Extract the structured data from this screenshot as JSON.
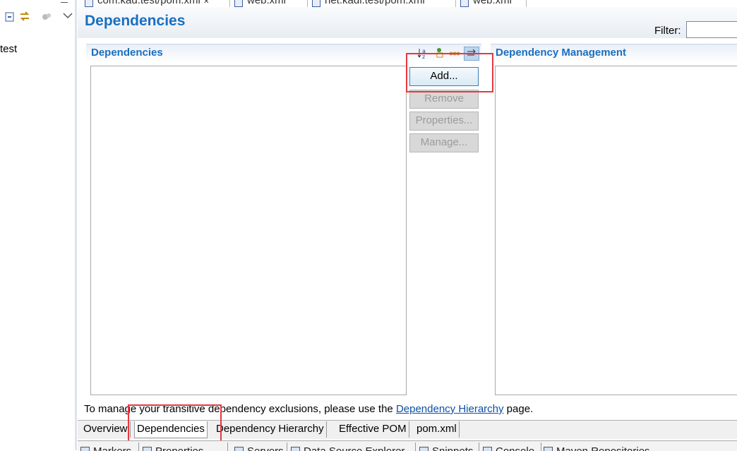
{
  "explorer": {
    "tree_item_label": "test"
  },
  "editor_tabs": [
    {
      "label": "com.kad.test/pom.xml",
      "close": "✕"
    },
    {
      "label": "web.xml"
    },
    {
      "label": "net.kadi.test/pom.xml"
    },
    {
      "label": "web.xml"
    }
  ],
  "page": {
    "title": "Dependencies",
    "filter_label": "Filter:",
    "filter_value": ""
  },
  "dependencies_section": {
    "title": "Dependencies",
    "buttons": {
      "add": "Add...",
      "remove": "Remove",
      "properties": "Properties...",
      "manage": "Manage..."
    }
  },
  "management_section": {
    "title": "Dependency Management"
  },
  "note": {
    "prefix": "To manage your transitive dependency exclusions, please use the ",
    "link": "Dependency Hierarchy",
    "suffix": " page."
  },
  "page_tabs": [
    "Overview",
    "Dependencies",
    "Dependency Hierarchy",
    "Effective POM",
    "pom.xml"
  ],
  "selected_page_tab": "Dependencies",
  "bottom_views": [
    "Markers",
    "Properties",
    "Servers",
    "Data Source Explorer",
    "Snippets",
    "Console",
    "Maven Repositories"
  ],
  "colors": {
    "title_blue": "#1a6fc0",
    "highlight_red": "#e8373f",
    "link_blue": "#0b4fa8"
  }
}
